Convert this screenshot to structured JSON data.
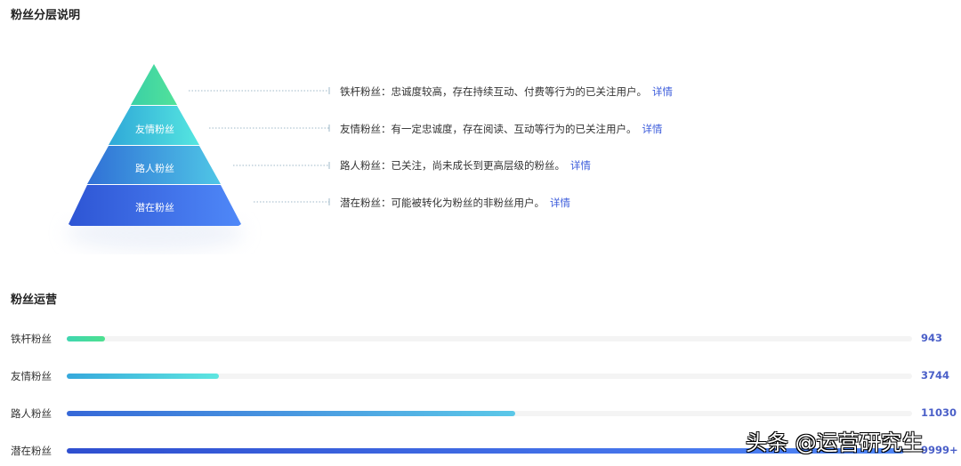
{
  "layer_section": {
    "title": "粉丝分层说明",
    "layers": [
      {
        "name": "铁杆粉丝",
        "pyramid_label": "",
        "desc": "铁杆粉丝：忠诚度较高，存在持续互动、付费等行为的已关注用户。",
        "link": "详情"
      },
      {
        "name": "友情粉丝",
        "pyramid_label": "友情粉丝",
        "desc": "友情粉丝：有一定忠诚度，存在阅读、互动等行为的已关注用户。",
        "link": "详情"
      },
      {
        "name": "路人粉丝",
        "pyramid_label": "路人粉丝",
        "desc": "路人粉丝：已关注，尚未成长到更高层级的粉丝。",
        "link": "详情"
      },
      {
        "name": "潜在粉丝",
        "pyramid_label": "潜在粉丝",
        "desc": "潜在粉丝：可能被转化为粉丝的非粉丝用户。",
        "link": "详情"
      }
    ]
  },
  "ops_section": {
    "title": "粉丝运营",
    "rows": [
      {
        "label": "铁杆粉丝",
        "value": "943",
        "fraction": 0.045,
        "from": "#3fd6b0",
        "to": "#4de08f"
      },
      {
        "label": "友情粉丝",
        "value": "3744",
        "fraction": 0.18,
        "from": "#36a8dc",
        "to": "#5ee6e0"
      },
      {
        "label": "路人粉丝",
        "value": "11030",
        "fraction": 0.53,
        "from": "#3668d8",
        "to": "#5bc8e8"
      },
      {
        "label": "潜在粉丝",
        "value": "9999+",
        "fraction": 0.99,
        "from": "#2f4fd0",
        "to": "#4f86f7"
      }
    ]
  },
  "watermark": "头条 @运营研究生"
}
